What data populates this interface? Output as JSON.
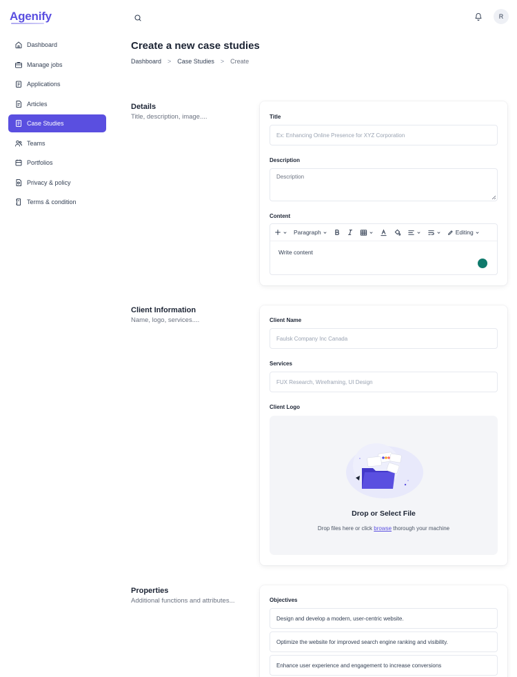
{
  "app": {
    "logo": "Agenify",
    "avatar_initial": "R"
  },
  "sidebar": {
    "items": [
      {
        "label": "Dashboard",
        "icon": "home-icon"
      },
      {
        "label": "Manage jobs",
        "icon": "briefcase-icon"
      },
      {
        "label": "Applications",
        "icon": "clipboard-icon"
      },
      {
        "label": "Articles",
        "icon": "article-icon"
      },
      {
        "label": "Case Studies",
        "icon": "document-icon",
        "active": true
      },
      {
        "label": "Teams",
        "icon": "users-icon"
      },
      {
        "label": "Portfolios",
        "icon": "portfolio-icon"
      },
      {
        "label": "Privacy & policy",
        "icon": "shield-doc-icon"
      },
      {
        "label": "Terms & condition",
        "icon": "terms-icon"
      }
    ]
  },
  "header": {
    "title": "Create a new case studies",
    "breadcrumb": [
      "Dashboard",
      "Case Studies",
      "Create"
    ]
  },
  "details": {
    "title": "Details",
    "subtitle": "Title, description, image....",
    "title_label": "Title",
    "title_placeholder": "Ex: Enhancing Online Presence for XYZ Corporation",
    "description_label": "Description",
    "description_placeholder": "Description",
    "content_label": "Content",
    "content_placeholder": "Write content",
    "toolbar": {
      "paragraph": "Paragraph",
      "editing": "Editing"
    }
  },
  "client": {
    "title": "Client Information",
    "subtitle": "Name, logo, services....",
    "name_label": "Client Name",
    "name_placeholder": "Faulsk Company Inc Canada",
    "services_label": "Services",
    "services_placeholder": "FUX Research, Wireframing, UI Design",
    "logo_label": "Client Logo",
    "upload_title": "Drop or Select File",
    "upload_prefix": "Drop files here or click ",
    "upload_link": "browse",
    "upload_suffix": " thorough your machine"
  },
  "properties": {
    "title": "Properties",
    "subtitle": "Additional functions and attributes...",
    "objectives_label": "Objectives",
    "objectives": [
      "Design and develop a modern, user-centric website.",
      "Optimize the website for improved search engine ranking and visibility.",
      "Enhance user experience and engagement to increase conversions"
    ]
  },
  "colors": {
    "accent": "#5a4fe0",
    "text": "#1c2434",
    "muted": "#6b7280"
  }
}
